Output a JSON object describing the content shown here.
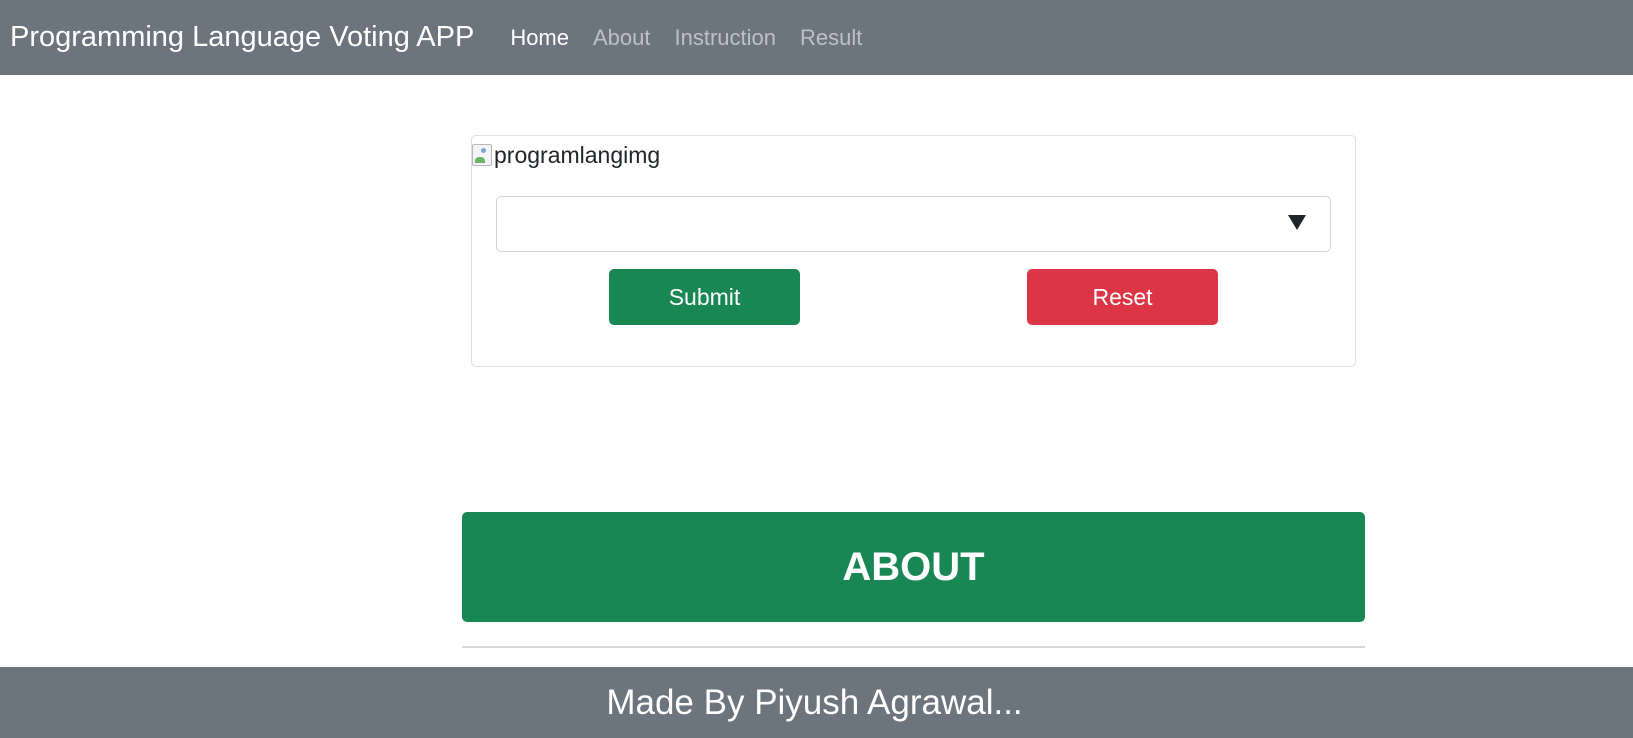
{
  "navbar": {
    "brand": "Programming Language Voting APP",
    "links": [
      {
        "label": "Home",
        "active": true
      },
      {
        "label": "About",
        "active": false
      },
      {
        "label": "Instruction",
        "active": false
      },
      {
        "label": "Result",
        "active": false
      }
    ]
  },
  "card": {
    "image_alt": "programlangimg",
    "select": {
      "selected_value": ""
    },
    "submit_label": "Submit",
    "reset_label": "Reset"
  },
  "about": {
    "title": "ABOUT"
  },
  "footer": {
    "text": "Made By Piyush Agrawal..."
  },
  "colors": {
    "navbar_bg": "#6c757d",
    "success": "#198754",
    "danger": "#dc3545"
  }
}
